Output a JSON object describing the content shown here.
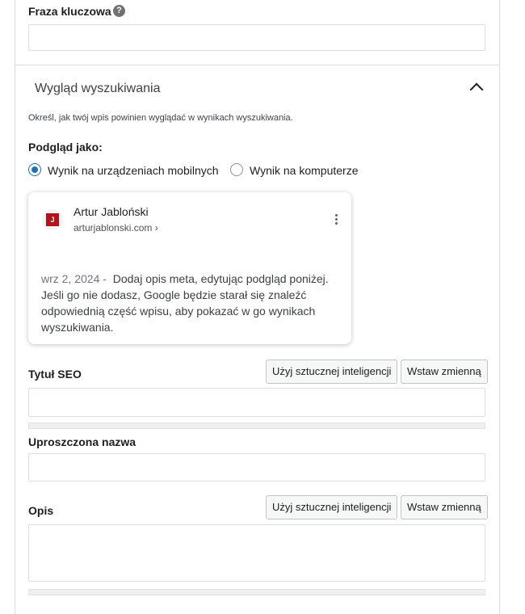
{
  "focus_keyphrase": {
    "label": "Fraza kluczowa",
    "help_icon": "question-mark",
    "value": ""
  },
  "search_appearance": {
    "title": "Wygląd wyszukiwania",
    "chevron_icon": "chevron-up",
    "intro": "Określ, jak twój wpis powinien wyglądać w wynikach wyszukiwania.",
    "preview_as_label": "Podgląd jako:",
    "options": [
      {
        "label": "Wynik na urządzeniach mobilnych",
        "checked": true
      },
      {
        "label": "Wynik na komputerze",
        "checked": false
      }
    ],
    "serp": {
      "favicon_letter": "J",
      "site_name": "Artur Jabloński",
      "url": "arturjablonski.com ›",
      "menu_icon": "more-vertical",
      "date": "wrz 2, 2024",
      "separator": " - ",
      "description": "Dodaj opis meta, edytując podgląd poniżej. Jeśli go nie dodasz, Google będzie starał się znaleźć odpowiednią część wpisu, aby pokazać w go wynikach wyszukiwania."
    }
  },
  "seo_title": {
    "label": "Tytuł SEO",
    "ai_button": "Użyj sztucznej inteligencji",
    "variable_button": "Wstaw zmienną",
    "value": ""
  },
  "slug": {
    "label": "Uproszczona nazwa",
    "value": ""
  },
  "meta_description": {
    "label": "Opis",
    "ai_button": "Użyj sztucznej inteligencji",
    "variable_button": "Wstaw zmienną",
    "value": ""
  },
  "colors": {
    "accent": "#2271b1",
    "favicon": "#b5121b"
  }
}
